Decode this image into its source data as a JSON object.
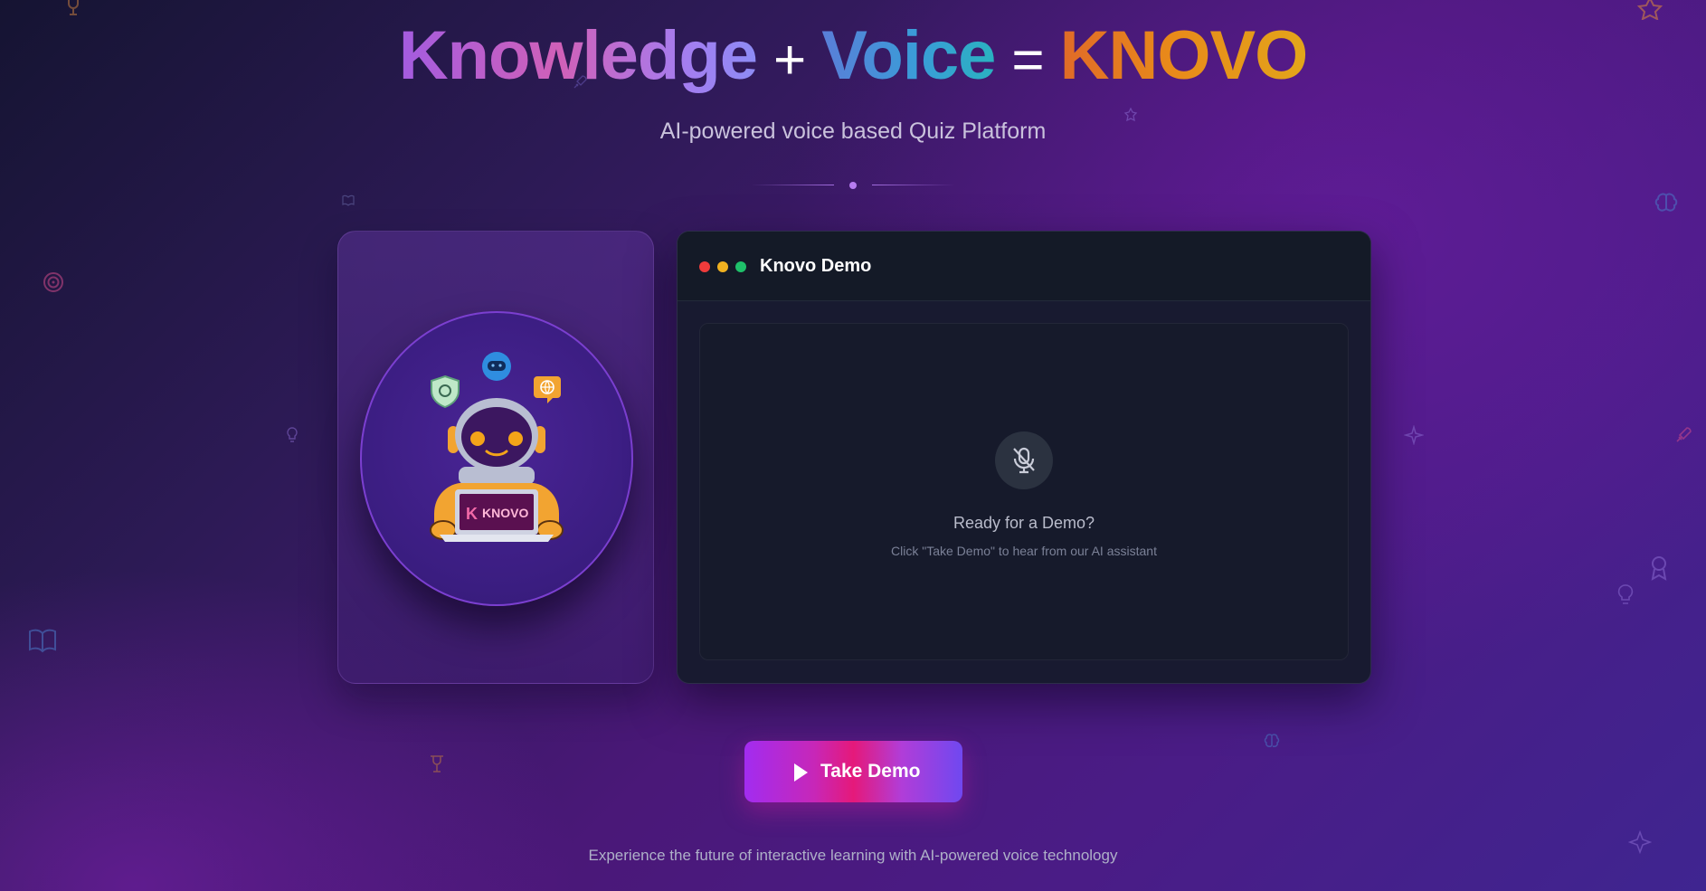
{
  "hero": {
    "title_part1": "Knowledge",
    "plus": "+",
    "title_part2": "Voice",
    "equals": "=",
    "title_part3": "KNOVO",
    "subtitle": "AI-powered voice based Quiz Platform"
  },
  "mascot": {
    "laptop_label": "KNOVO",
    "laptop_logo_letter": "K",
    "icons": [
      "shield-icon",
      "gamepad-icon",
      "globe-icon"
    ]
  },
  "demo": {
    "window_title": "Knovo Demo",
    "status_title": "Ready for a Demo?",
    "status_hint": "Click \"Take Demo\" to hear from our AI assistant",
    "mic_icon": "mic-off-icon"
  },
  "cta": {
    "label": "Take Demo",
    "icon": "play-icon"
  },
  "footer": {
    "text": "Experience the future of interactive learning with AI-powered voice technology"
  },
  "colors": {
    "accent_purple": "#a22cf0",
    "accent_pink": "#e5197a",
    "knovo_orange": "#e88a1a",
    "voice_blue": "#3a9cd8"
  },
  "background_icons": [
    "trophy-icon",
    "star-icon",
    "target-icon",
    "book-icon",
    "lightbulb-icon",
    "brain-icon",
    "sparkle-icon",
    "rocket-icon",
    "award-icon"
  ]
}
